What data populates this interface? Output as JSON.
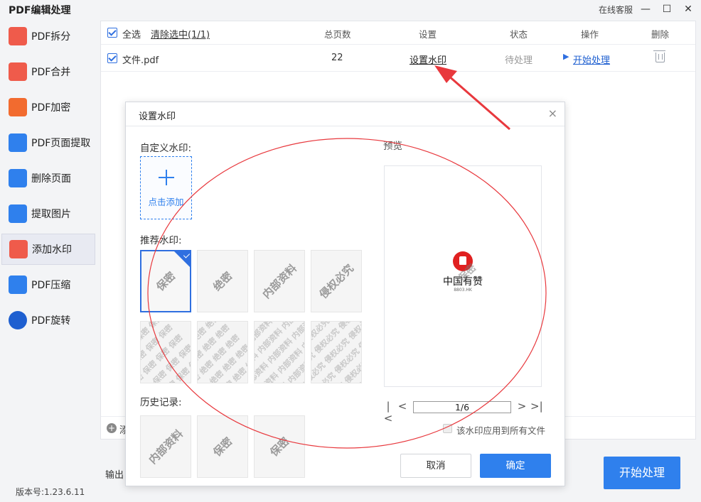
{
  "window": {
    "title": "PDF编辑处理",
    "service_link": "在线客服",
    "minimize": "—",
    "maximize": "☐",
    "close": "✕"
  },
  "sidebar": {
    "items": [
      {
        "label": "PDF拆分",
        "icon": "split-icon",
        "color": "#ef5b4b"
      },
      {
        "label": "PDF合并",
        "icon": "merge-icon",
        "color": "#ef5b4b"
      },
      {
        "label": "PDF加密",
        "icon": "lock-icon",
        "color": "#f26b2f"
      },
      {
        "label": "PDF页面提取",
        "icon": "page-extract-icon",
        "color": "#2f80ed"
      },
      {
        "label": "删除页面",
        "icon": "delete-page-icon",
        "color": "#2f80ed"
      },
      {
        "label": "提取图片",
        "icon": "image-extract-icon",
        "color": "#2f80ed"
      },
      {
        "label": "添加水印",
        "icon": "watermark-icon",
        "color": "#ef5b4b",
        "active": true
      },
      {
        "label": "PDF压缩",
        "icon": "compress-icon",
        "color": "#2f80ed"
      },
      {
        "label": "PDF旋转",
        "icon": "rotate-icon",
        "color": "#1e5fd0"
      }
    ],
    "version": "版本号:1.23.6.11"
  },
  "table": {
    "select_all": "全选",
    "clear_selected": "清除选中(1/1)",
    "headers": {
      "pages": "总页数",
      "settings": "设置",
      "status": "状态",
      "action": "操作",
      "delete": "删除"
    },
    "rows": [
      {
        "file": "文件.pdf",
        "pages": "22",
        "settings_link": "设置水印",
        "status": "待处理",
        "action": "开始处理"
      }
    ],
    "add_file": "添",
    "output_label": "输出",
    "start_button": "开始处理"
  },
  "dialog": {
    "title": "设置水印",
    "close": "×",
    "custom_label": "自定义水印:",
    "add_label": "点击添加",
    "recommended_label": "推荐水印:",
    "recommended": [
      "保密",
      "绝密",
      "内部资料",
      "侵权必究"
    ],
    "tiled_pattern": [
      "保密",
      "绝密",
      "内部资料",
      "侵权必究"
    ],
    "history_label": "历史记录:",
    "history": [
      "内部资料",
      "保密",
      "保密"
    ],
    "preview_label": "预览",
    "preview_name": "中国有赞",
    "preview_sub": "8803.HK",
    "preview_watermark": "保密",
    "pager": {
      "first": "|<",
      "prev": "<",
      "value": "1/6",
      "next": ">",
      "last": ">|"
    },
    "apply_all": "该水印应用到所有文件",
    "cancel": "取消",
    "ok": "确定"
  },
  "colors": {
    "accent": "#2f80ed",
    "annotation": "#e8383d"
  }
}
